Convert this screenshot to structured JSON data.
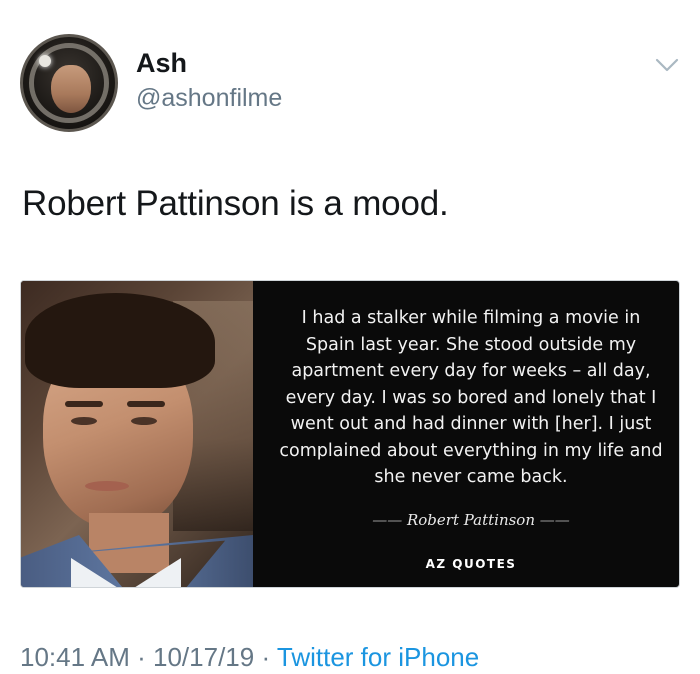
{
  "author": {
    "name": "Ash",
    "handle": "@ashonfilme",
    "avatar_icon": "astronaut-avatar-icon"
  },
  "menu_icon": "chevron-down-icon",
  "tweet": {
    "text": "Robert Pattinson is a mood."
  },
  "quote_card": {
    "photo_icon": "portrait-photo",
    "quote": "I had a stalker while filming a movie in Spain last year. She stood outside my apartment every day for weeks – all day, every day. I was so bored and lonely that I went out and had dinner with [her]. I just complained about everything in my life and she never came back.",
    "author": "Robert Pattinson",
    "source": "AZ QUOTES"
  },
  "meta": {
    "time": "10:41 AM",
    "date": "10/17/19",
    "client": "Twitter for iPhone",
    "separator": "·"
  },
  "colors": {
    "text_primary": "#14171a",
    "text_secondary": "#657786",
    "link": "#1b95e0",
    "card_background": "#0a0a0a"
  }
}
